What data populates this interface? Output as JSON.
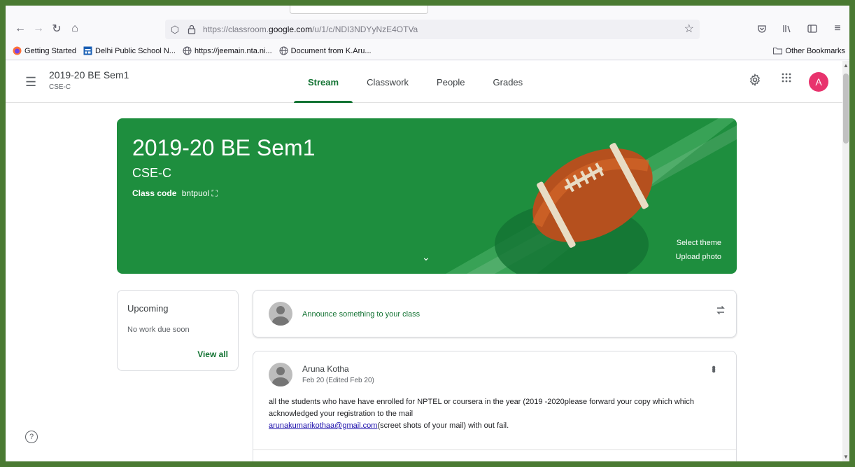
{
  "browser": {
    "url_prefix": "https://classroom.",
    "url_domain": "google.com",
    "url_path": "/u/1/c/NDI3NDYyNzE4OTVa",
    "bookmarks": [
      {
        "label": "Getting Started",
        "icon": "firefox-icon"
      },
      {
        "label": "Delhi Public School N...",
        "icon": "calendar-icon"
      },
      {
        "label": "https://jeemain.nta.ni...",
        "icon": "globe-icon"
      },
      {
        "label": "Document from K.Aru...",
        "icon": "globe-icon"
      }
    ],
    "other_bookmarks": "Other Bookmarks"
  },
  "header": {
    "title": "2019-20 BE Sem1",
    "subtitle": "CSE-C",
    "avatar_letter": "A",
    "tabs": [
      {
        "label": "Stream",
        "active": true
      },
      {
        "label": "Classwork",
        "active": false
      },
      {
        "label": "People",
        "active": false
      },
      {
        "label": "Grades",
        "active": false
      }
    ]
  },
  "banner": {
    "title": "2019-20 BE Sem1",
    "subtitle": "CSE-C",
    "class_code_label": "Class code",
    "class_code": "bntpuol",
    "select_theme": "Select theme",
    "upload_photo": "Upload photo",
    "color": "#1e8e3e"
  },
  "upcoming": {
    "title": "Upcoming",
    "empty_text": "No work due soon",
    "view_all": "View all"
  },
  "announce": {
    "placeholder": "Announce something to your class"
  },
  "post": {
    "author": "Aruna Kotha",
    "date": "Feb 20 (Edited Feb 20)",
    "body": "all the students who have have enrolled for NPTEL or coursera in the year (2019 -2020please forward your copy which which acknowledged your registration to the mail",
    "email": "arunakumarikothaa@gmail.com",
    "body_tail": "(screet shots of your mail) with out fail."
  },
  "colors": {
    "accent": "#137333",
    "avatar": "#e8336d",
    "frame": "#4a7a32"
  }
}
